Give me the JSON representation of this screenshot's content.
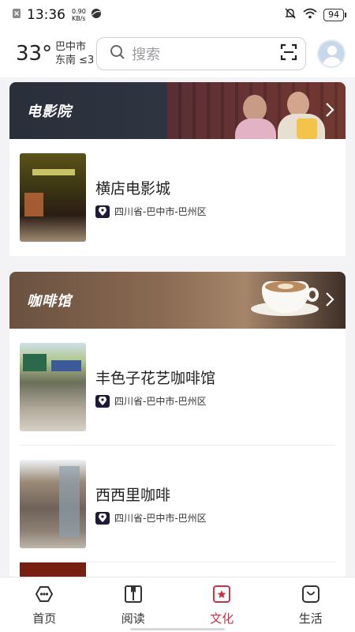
{
  "status_bar": {
    "time": "13:36",
    "net_speed_value": "0.90",
    "net_speed_unit": "KB/s",
    "battery": "94",
    "icons": [
      "sim-off-icon",
      "browser-icon",
      "mute-icon",
      "wifi-icon",
      "battery-icon"
    ]
  },
  "header": {
    "temperature": "33°",
    "city": "巴中市",
    "wind": "东南 ≤3",
    "search_placeholder": "搜索",
    "icons": [
      "search-icon",
      "scan-icon",
      "avatar-icon"
    ]
  },
  "sections": [
    {
      "title": "电影院",
      "items": [
        {
          "name": "横店电影城",
          "address": "四川省-巴中市-巴州区"
        }
      ]
    },
    {
      "title": "咖啡馆",
      "items": [
        {
          "name": "丰色子花艺咖啡馆",
          "address": "四川省-巴中市-巴州区"
        },
        {
          "name": "西西里咖啡",
          "address": "四川省-巴中市-巴州区"
        }
      ]
    }
  ],
  "tabs": [
    {
      "label": "首页",
      "icon": "home-icon",
      "active": false
    },
    {
      "label": "阅读",
      "icon": "book-icon",
      "active": false
    },
    {
      "label": "文化",
      "icon": "culture-star-icon",
      "active": true
    },
    {
      "label": "生活",
      "icon": "life-bag-icon",
      "active": false
    }
  ],
  "colors": {
    "accent": "#c9304a",
    "pin_bg": "#1c1b3a",
    "cinema_banner": "#2e3440",
    "coffee_banner": "#8a6a52"
  }
}
